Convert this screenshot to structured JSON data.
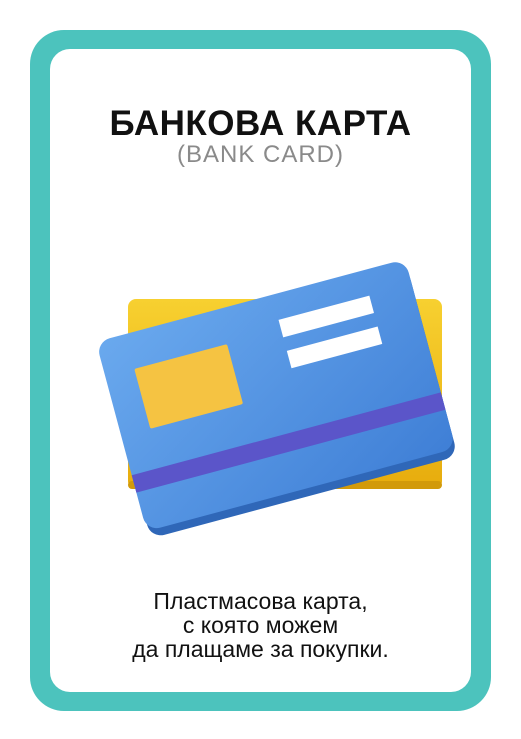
{
  "card": {
    "title": "БАНКОВА КАРТА",
    "subtitle": "(BANK CARD)",
    "description_lines": [
      "Пластмасова карта,",
      "с която можем",
      "да плащаме за покупки."
    ]
  },
  "colors": {
    "frame": "#4cc3bd",
    "background": "#ffffff",
    "front_card": "#4f8fe0",
    "back_card": "#f2c21b",
    "chip": "#f5c342",
    "magnetic_stripe": "#5b55c9"
  },
  "illustration": {
    "icon": "bank-card-icon"
  }
}
